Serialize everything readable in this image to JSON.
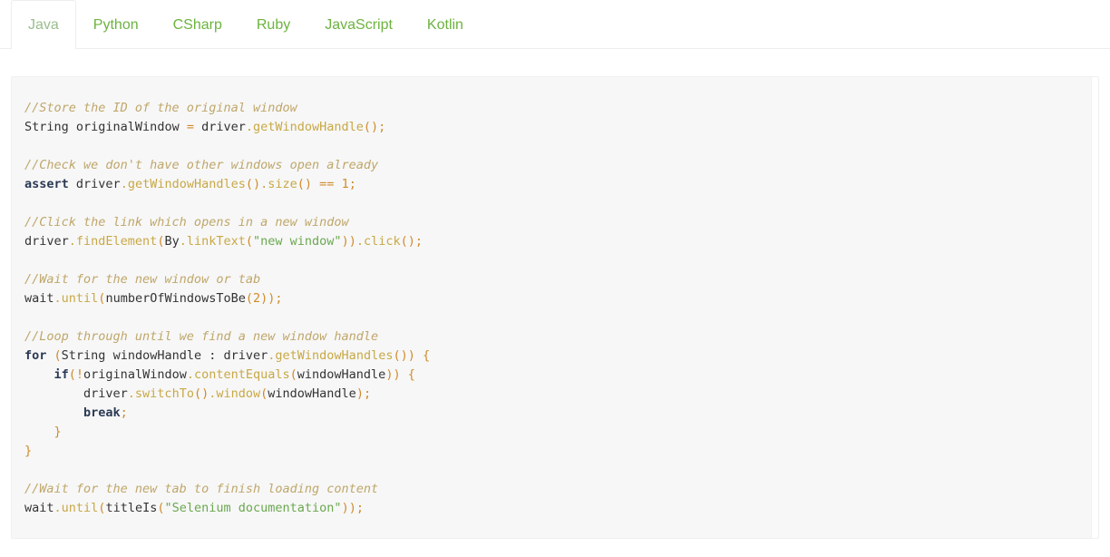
{
  "tabs": {
    "items": [
      {
        "label": "Java",
        "active": true
      },
      {
        "label": "Python",
        "active": false
      },
      {
        "label": "CSharp",
        "active": false
      },
      {
        "label": "Ruby",
        "active": false
      },
      {
        "label": "JavaScript",
        "active": false
      },
      {
        "label": "Kotlin",
        "active": false
      }
    ]
  },
  "colors": {
    "tab_inactive": "#6cb33f",
    "tab_active": "#9bbd8c",
    "code_background": "#f7f7f7",
    "code_border": "#f0f0f0",
    "comment": "#bfa76a",
    "keyword": "#2b3a55",
    "function": "#c8a846",
    "punctuation": "#d08b2c",
    "string": "#6aa84f",
    "number": "#d08b2c",
    "plain": "#333333"
  },
  "code": {
    "language": "Java",
    "lines": [
      [
        {
          "t": "//Store the ID of the original window",
          "k": "cmt"
        }
      ],
      [
        {
          "t": "String",
          "k": "type"
        },
        {
          "t": " originalWindow ",
          "k": "plain"
        },
        {
          "t": "=",
          "k": "punct"
        },
        {
          "t": " driver",
          "k": "plain"
        },
        {
          "t": ".getWindowHandle",
          "k": "fn"
        },
        {
          "t": "();",
          "k": "punct"
        }
      ],
      [],
      [
        {
          "t": "//Check we don't have other windows open already",
          "k": "cmt"
        }
      ],
      [
        {
          "t": "assert",
          "k": "kw"
        },
        {
          "t": " driver",
          "k": "plain"
        },
        {
          "t": ".getWindowHandles",
          "k": "fn"
        },
        {
          "t": "()",
          "k": "punct"
        },
        {
          "t": ".size",
          "k": "fn"
        },
        {
          "t": "() ",
          "k": "punct"
        },
        {
          "t": "==",
          "k": "punct"
        },
        {
          "t": " ",
          "k": "plain"
        },
        {
          "t": "1",
          "k": "num"
        },
        {
          "t": ";",
          "k": "punct"
        }
      ],
      [],
      [
        {
          "t": "//Click the link which opens in a new window",
          "k": "cmt"
        }
      ],
      [
        {
          "t": "driver",
          "k": "plain"
        },
        {
          "t": ".findElement",
          "k": "fn"
        },
        {
          "t": "(",
          "k": "punct"
        },
        {
          "t": "By",
          "k": "plain"
        },
        {
          "t": ".linkText",
          "k": "fn"
        },
        {
          "t": "(",
          "k": "punct"
        },
        {
          "t": "\"new window\"",
          "k": "str"
        },
        {
          "t": "))",
          "k": "punct"
        },
        {
          "t": ".click",
          "k": "fn"
        },
        {
          "t": "();",
          "k": "punct"
        }
      ],
      [],
      [
        {
          "t": "//Wait for the new window or tab",
          "k": "cmt"
        }
      ],
      [
        {
          "t": "wait",
          "k": "plain"
        },
        {
          "t": ".until",
          "k": "fn"
        },
        {
          "t": "(",
          "k": "punct"
        },
        {
          "t": "numberOfWindowsToBe",
          "k": "plain"
        },
        {
          "t": "(",
          "k": "punct"
        },
        {
          "t": "2",
          "k": "num"
        },
        {
          "t": "));",
          "k": "punct"
        }
      ],
      [],
      [
        {
          "t": "//Loop through until we find a new window handle",
          "k": "cmt"
        }
      ],
      [
        {
          "t": "for",
          "k": "kw"
        },
        {
          "t": " (",
          "k": "punct"
        },
        {
          "t": "String",
          "k": "type"
        },
        {
          "t": " windowHandle ",
          "k": "plain"
        },
        {
          "t": ":",
          "k": "plain"
        },
        {
          "t": " driver",
          "k": "plain"
        },
        {
          "t": ".getWindowHandles",
          "k": "fn"
        },
        {
          "t": "()) {",
          "k": "punct"
        }
      ],
      [
        {
          "t": "    ",
          "k": "plain"
        },
        {
          "t": "if",
          "k": "kw"
        },
        {
          "t": "(!",
          "k": "punct"
        },
        {
          "t": "originalWindow",
          "k": "plain"
        },
        {
          "t": ".contentEquals",
          "k": "fn"
        },
        {
          "t": "(",
          "k": "punct"
        },
        {
          "t": "windowHandle",
          "k": "plain"
        },
        {
          "t": ")) {",
          "k": "punct"
        }
      ],
      [
        {
          "t": "        driver",
          "k": "plain"
        },
        {
          "t": ".switchTo",
          "k": "fn"
        },
        {
          "t": "()",
          "k": "punct"
        },
        {
          "t": ".window",
          "k": "fn"
        },
        {
          "t": "(",
          "k": "punct"
        },
        {
          "t": "windowHandle",
          "k": "plain"
        },
        {
          "t": ");",
          "k": "punct"
        }
      ],
      [
        {
          "t": "        ",
          "k": "plain"
        },
        {
          "t": "break",
          "k": "kw"
        },
        {
          "t": ";",
          "k": "punct"
        }
      ],
      [
        {
          "t": "    }",
          "k": "punct"
        }
      ],
      [
        {
          "t": "}",
          "k": "punct"
        }
      ],
      [],
      [
        {
          "t": "//Wait for the new tab to finish loading content",
          "k": "cmt"
        }
      ],
      [
        {
          "t": "wait",
          "k": "plain"
        },
        {
          "t": ".until",
          "k": "fn"
        },
        {
          "t": "(",
          "k": "punct"
        },
        {
          "t": "titleIs",
          "k": "plain"
        },
        {
          "t": "(",
          "k": "punct"
        },
        {
          "t": "\"Selenium documentation\"",
          "k": "str"
        },
        {
          "t": "));",
          "k": "punct"
        }
      ]
    ]
  }
}
